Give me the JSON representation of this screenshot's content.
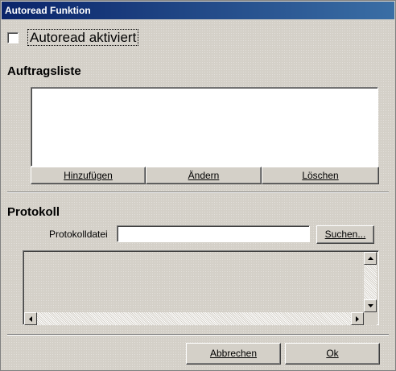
{
  "window": {
    "title": "Autoread Funktion"
  },
  "autoread": {
    "checkbox_label": "Autoread aktiviert",
    "checked": false
  },
  "auftragsliste": {
    "title": "Auftragsliste",
    "items": [],
    "buttons": {
      "add": "Hinzufügen",
      "edit": "Ändern",
      "delete": "Löschen"
    }
  },
  "protokoll": {
    "title": "Protokoll",
    "file_label": "Protokolldatei",
    "file_value": "",
    "search_button": "Suchen..."
  },
  "footer": {
    "cancel": "Abbrechen",
    "ok": "Ok"
  },
  "icons": {
    "scroll_up": "arrow-up-icon",
    "scroll_down": "arrow-down-icon",
    "scroll_left": "arrow-left-icon",
    "scroll_right": "arrow-right-icon"
  }
}
